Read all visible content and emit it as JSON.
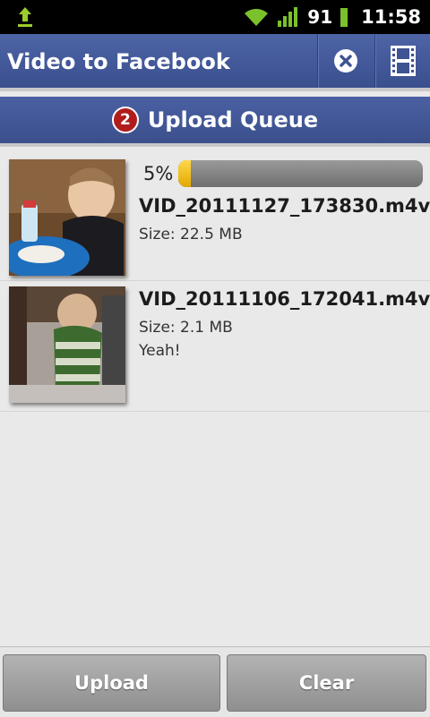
{
  "status_bar": {
    "battery_level": "91",
    "time": "11:58",
    "icons": [
      "upload-notification-icon",
      "wifi-icon",
      "signal-icon",
      "battery-icon"
    ]
  },
  "app_bar": {
    "title": "Video to Facebook",
    "actions": [
      "cancel-icon",
      "film-strip-icon"
    ]
  },
  "queue": {
    "count": "2",
    "title": "Upload Queue"
  },
  "items": [
    {
      "progress_label": "5%",
      "progress_fraction": 0.05,
      "filename": "VID_20111127_173830.m4v",
      "size_label": "Size:",
      "size_value": "22.5 MB",
      "caption": ""
    },
    {
      "filename": "VID_20111106_172041.m4v",
      "size_label": "Size:",
      "size_value": "2.1 MB",
      "caption": "Yeah!"
    }
  ],
  "buttons": {
    "upload": "Upload",
    "clear": "Clear"
  },
  "colors": {
    "app_bar": "#3e5391",
    "badge": "#b01c1c",
    "progress_fill": "#f2c10f"
  }
}
